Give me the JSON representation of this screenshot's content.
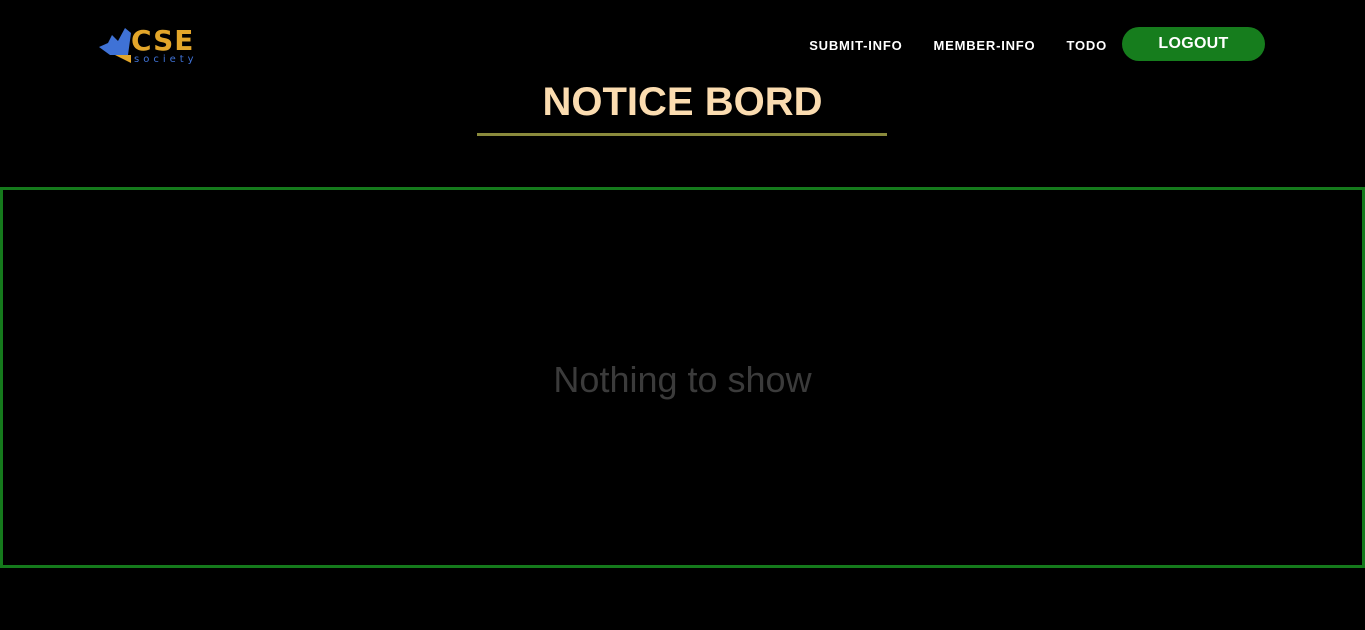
{
  "logo": {
    "text": "CSE",
    "subtext": "society",
    "colors": {
      "primary": "#e3a62a",
      "secondary": "#3f72d6"
    }
  },
  "nav": {
    "links": [
      {
        "label": "SUBMIT-INFO"
      },
      {
        "label": "MEMBER-INFO"
      },
      {
        "label": "TODO"
      }
    ],
    "logout_label": "LOGOUT"
  },
  "page": {
    "title": "NOTICE BORD",
    "empty_message": "Nothing to show"
  },
  "colors": {
    "background": "#000000",
    "accent_green": "#167d1d",
    "title": "#fbdcb0",
    "underline": "#8a8a3c",
    "empty_text": "#3b3b3b"
  }
}
